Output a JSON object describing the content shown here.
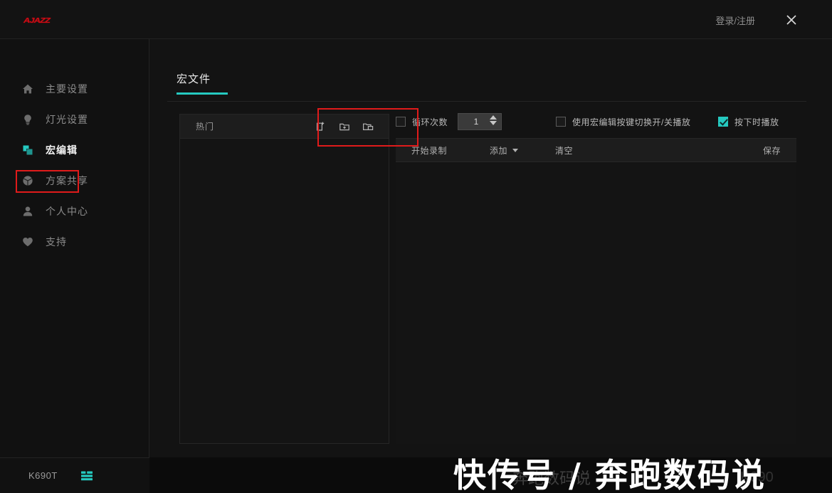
{
  "window": {
    "logo_text": "AJAZZ",
    "login_label": "登录/注册",
    "close_icon": "close-icon"
  },
  "sidebar": {
    "items": [
      {
        "label": "主要设置",
        "icon": "home-icon",
        "active": false
      },
      {
        "label": "灯光设置",
        "icon": "bulb-icon",
        "active": false
      },
      {
        "label": "宏编辑",
        "icon": "macro-icon",
        "active": true
      },
      {
        "label": "方案共享",
        "icon": "share-icon",
        "active": false
      },
      {
        "label": "个人中心",
        "icon": "user-icon",
        "active": false
      },
      {
        "label": "支持",
        "icon": "heart-icon",
        "active": false
      }
    ]
  },
  "statusbar": {
    "device_name": "K690T",
    "device_icon": "keyboard-layers-icon"
  },
  "tabs": [
    {
      "label": "宏文件",
      "active": true
    }
  ],
  "macro_list": {
    "title": "热门",
    "actions": [
      {
        "name": "new-file-icon",
        "title": "新建文件"
      },
      {
        "name": "new-folder-icon",
        "title": "新建文件夹"
      },
      {
        "name": "duplicate-icon",
        "title": "复制"
      }
    ],
    "items": []
  },
  "editor": {
    "options": [
      {
        "label": "循环次数",
        "checked": false,
        "has_spinner": true,
        "spinner_value": "1"
      },
      {
        "label": "使用宏编辑按键切换开/关播放",
        "checked": false,
        "has_spinner": false
      },
      {
        "label": "按下时播放",
        "checked": true,
        "has_spinner": false
      }
    ],
    "toolbar": {
      "record_label": "开始录制",
      "add_label": "添加",
      "clear_label": "清空",
      "save_label": "保存"
    },
    "rows": []
  },
  "watermark": {
    "text": "快传号 / 奔跑数码说",
    "ghost_text": "奔跑数码说",
    "ghost_text2": "K690"
  },
  "colors": {
    "accent": "#25c9c0",
    "brand": "#cc0b14",
    "highlight": "#e01b1b",
    "background": "#111111",
    "panel": "#141414"
  }
}
